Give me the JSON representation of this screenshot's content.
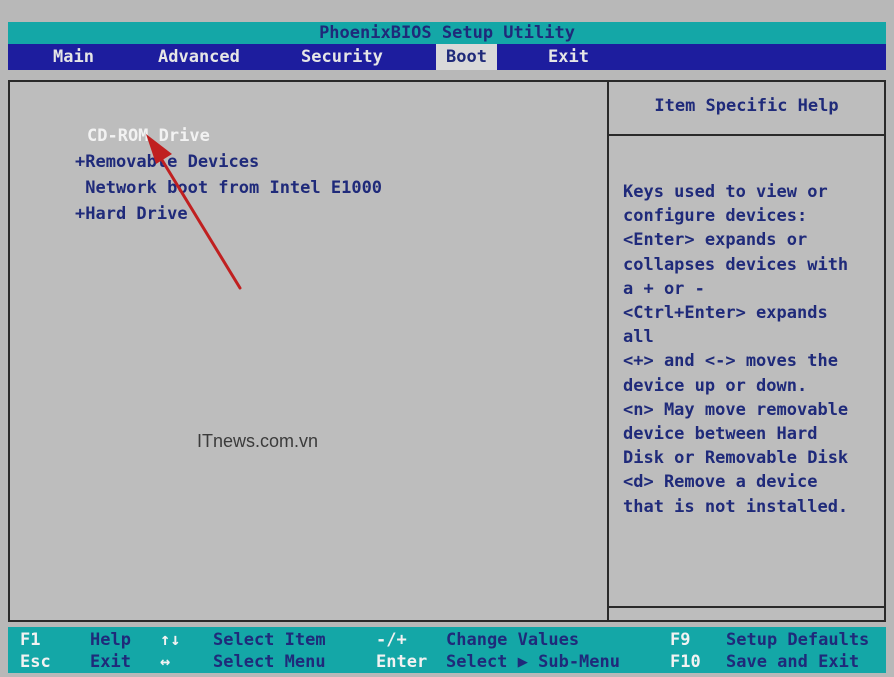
{
  "window": {
    "title": "PhoenixBIOS Setup Utility"
  },
  "menu": [
    {
      "label": "Main",
      "active": false
    },
    {
      "label": "Advanced",
      "active": false
    },
    {
      "label": "Security",
      "active": false
    },
    {
      "label": "Boot",
      "active": true
    },
    {
      "label": "Exit",
      "active": false
    }
  ],
  "boot_list": [
    {
      "label": "CD-ROM Drive",
      "selected": true
    },
    {
      "label": "+Removable Devices",
      "selected": false
    },
    {
      "label": " Network boot from Intel E1000",
      "selected": false
    },
    {
      "label": "+Hard Drive",
      "selected": false
    }
  ],
  "help": {
    "title": "Item Specific Help",
    "lines": [
      "Keys used to view or",
      "configure devices:",
      "<Enter> expands or",
      "collapses devices with",
      "a + or -",
      "<Ctrl+Enter> expands",
      "all",
      "<+> and <-> moves the",
      "device up or down.",
      "<n> May move removable",
      "device between Hard",
      "Disk or Removable Disk",
      "<d> Remove a device",
      "that is not installed."
    ]
  },
  "watermark": "ITnews.com.vn",
  "status_bar": {
    "row1": [
      {
        "key": "F1",
        "desc": "Help"
      },
      {
        "key": "↑↓",
        "desc": "Select Item"
      },
      {
        "key": "-/+",
        "desc": "Change Values"
      },
      {
        "key": "F9",
        "desc": "Setup Defaults"
      }
    ],
    "row2": [
      {
        "key": "Esc",
        "desc": "Exit"
      },
      {
        "key": "↔",
        "desc": "Select Menu"
      },
      {
        "key": "Enter",
        "desc": "Select ▶ Sub-Menu"
      },
      {
        "key": "F10",
        "desc": "Save and Exit"
      }
    ]
  },
  "colors": {
    "title_bg": "#14a7a7",
    "menu_bg": "#1d1d9e",
    "panel_bg": "#bdbdbd",
    "text_blue": "#1f2a7a",
    "selected_text": "#f2f2f2",
    "arrow": "#c02020"
  }
}
